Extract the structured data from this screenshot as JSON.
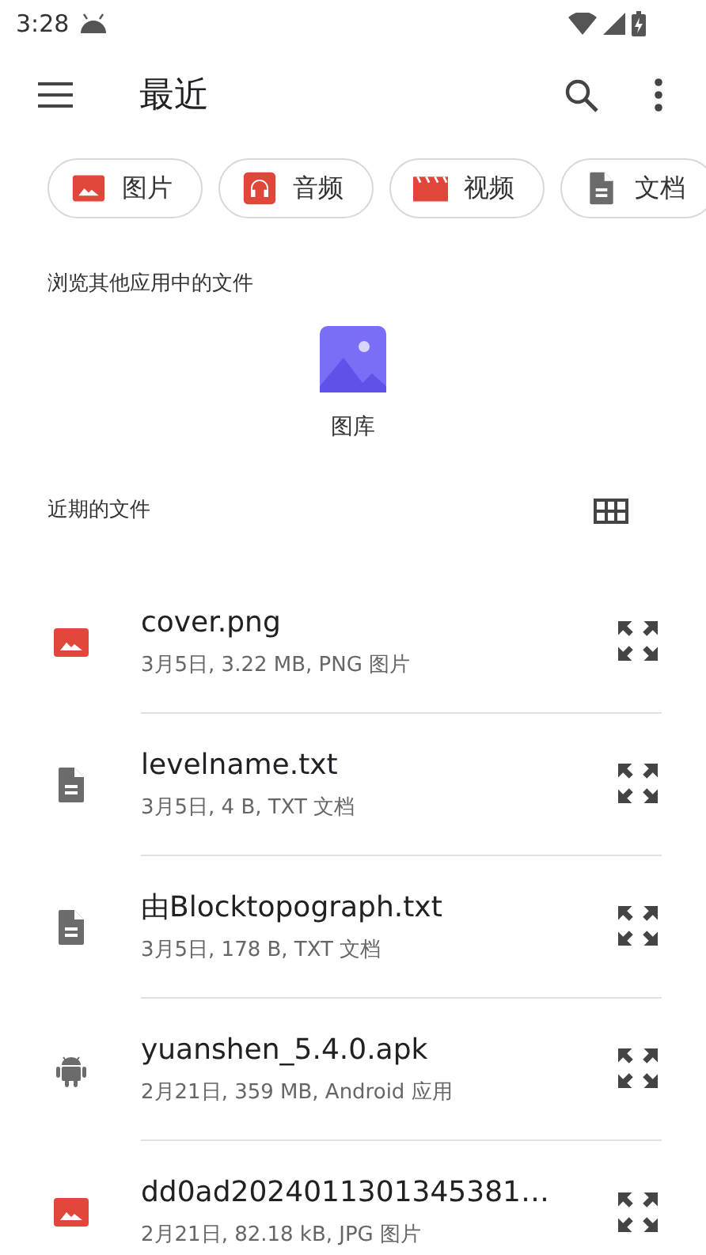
{
  "status_bar": {
    "time": "3:28"
  },
  "toolbar": {
    "title": "最近"
  },
  "chips": [
    {
      "label": "图片",
      "kind": "image"
    },
    {
      "label": "音频",
      "kind": "audio"
    },
    {
      "label": "视频",
      "kind": "video"
    },
    {
      "label": "文档",
      "kind": "document"
    }
  ],
  "browse_section": {
    "heading": "浏览其他应用中的文件",
    "apps": [
      {
        "label": "图库"
      }
    ]
  },
  "recent_section": {
    "heading": "近期的文件"
  },
  "files": [
    {
      "name": "cover.png",
      "details": "3月5日, 3.22 MB, PNG 图片",
      "kind": "image"
    },
    {
      "name": "levelname.txt",
      "details": "3月5日, 4 B, TXT 文档",
      "kind": "document"
    },
    {
      "name": "由Blocktopograph.txt",
      "details": "3月5日, 178 B, TXT 文档",
      "kind": "document"
    },
    {
      "name": "yuanshen_5.4.0.apk",
      "details": "2月21日, 359 MB, Android 应用",
      "kind": "apk"
    },
    {
      "name": "dd0ad2024011301345381…",
      "details": "2月21日, 82.18 kB, JPG 图片",
      "kind": "image"
    }
  ]
}
